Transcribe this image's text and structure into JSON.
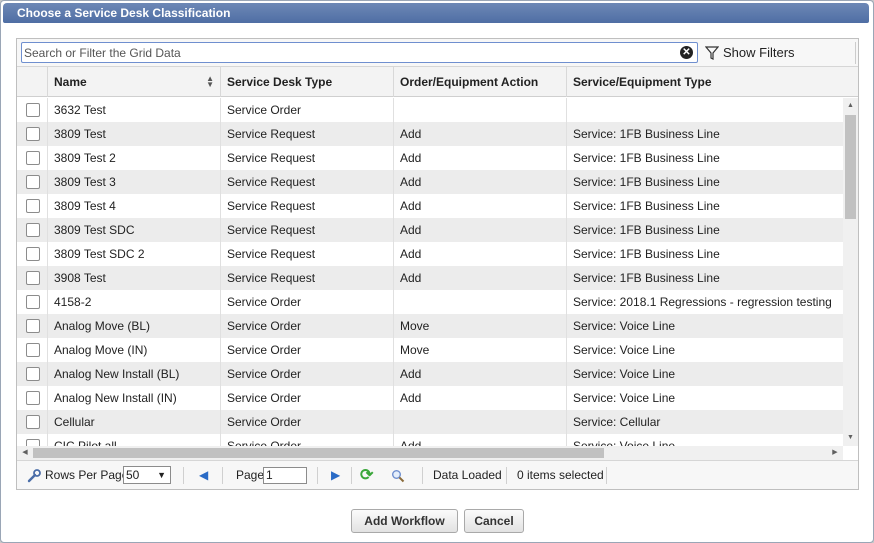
{
  "dialog": {
    "title": "Choose a Service Desk Classification"
  },
  "search": {
    "placeholder": "Search or Filter the Grid Data",
    "value": "",
    "show_filters_label": "Show Filters"
  },
  "columns": [
    "Name",
    "Service Desk Type",
    "Order/Equipment Action",
    "Service/Equipment Type"
  ],
  "rows": [
    [
      "3632 Test",
      "Service Order",
      "",
      ""
    ],
    [
      "3809 Test",
      "Service Request",
      "Add",
      "Service: 1FB Business Line"
    ],
    [
      "3809 Test 2",
      "Service Request",
      "Add",
      "Service: 1FB Business Line"
    ],
    [
      "3809 Test 3",
      "Service Request",
      "Add",
      "Service: 1FB Business Line"
    ],
    [
      "3809 Test 4",
      "Service Request",
      "Add",
      "Service: 1FB Business Line"
    ],
    [
      "3809 Test SDC",
      "Service Request",
      "Add",
      "Service: 1FB Business Line"
    ],
    [
      "3809 Test SDC 2",
      "Service Request",
      "Add",
      "Service: 1FB Business Line"
    ],
    [
      "3908 Test",
      "Service Request",
      "Add",
      "Service: 1FB Business Line"
    ],
    [
      "4158-2",
      "Service Order",
      "",
      "Service: 2018.1 Regressions - regression testing"
    ],
    [
      "Analog Move (BL)",
      "Service Order",
      "Move",
      "Service: Voice Line"
    ],
    [
      "Analog Move (IN)",
      "Service Order",
      "Move",
      "Service: Voice Line"
    ],
    [
      "Analog New Install (BL)",
      "Service Order",
      "Add",
      "Service: Voice Line"
    ],
    [
      "Analog New Install (IN)",
      "Service Order",
      "Add",
      "Service: Voice Line"
    ],
    [
      "Cellular",
      "Service Order",
      "",
      "Service: Cellular"
    ],
    [
      "CIC Pilot all",
      "Service Order",
      "Add",
      "Service: Voice Line"
    ]
  ],
  "footer": {
    "rows_per_page_label": "Rows Per Page:",
    "rows_per_page_value": "50",
    "page_label": "Page:",
    "page_value": "1",
    "status": "Data Loaded",
    "selection": "0 items selected"
  },
  "buttons": {
    "add_workflow": "Add Workflow",
    "cancel": "Cancel"
  },
  "colors": {
    "title_bar": "#5a76aa",
    "search_border": "#6f8fcf",
    "row_alt": "#ececec",
    "nav_arrow": "#2a6bc6",
    "refresh": "#3aa63a"
  },
  "icons": [
    "clear-icon",
    "filter-icon",
    "sort-icon",
    "wrench-icon",
    "prev-page-icon",
    "next-page-icon",
    "refresh-icon",
    "search-icon"
  ]
}
